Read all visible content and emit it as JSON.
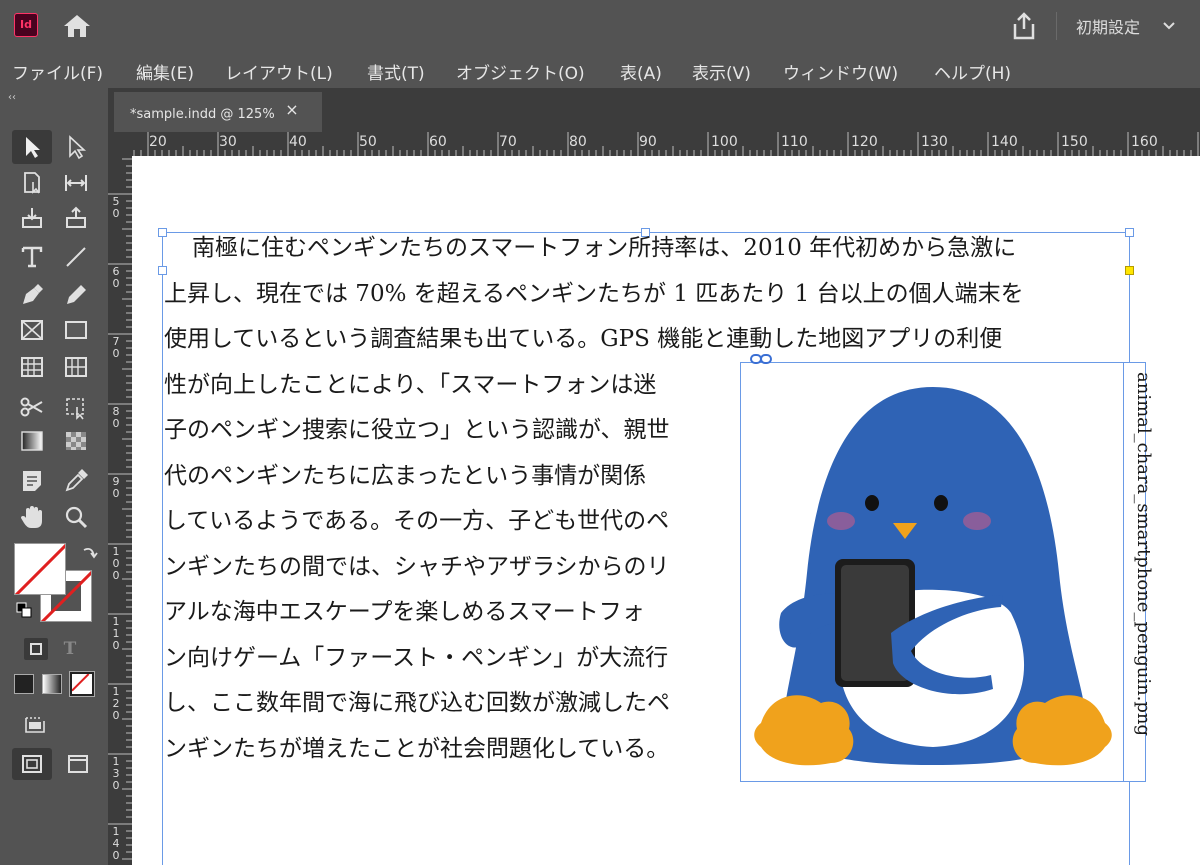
{
  "app": {
    "logo": "Id",
    "workspace": "初期設定"
  },
  "menu": [
    "ファイル(F)",
    "編集(E)",
    "レイアウト(L)",
    "書式(T)",
    "オブジェクト(O)",
    "表(A)",
    "表示(V)",
    "ウィンドウ(W)",
    "ヘルプ(H)"
  ],
  "document_tab": {
    "label": "*sample.indd @ 125%",
    "close": "×"
  },
  "ruler_h": [
    "20",
    "30",
    "40",
    "50",
    "60",
    "70",
    "80",
    "90",
    "100",
    "110",
    "120",
    "130",
    "140",
    "150",
    "160"
  ],
  "ruler_v": [
    "50",
    "60",
    "70",
    "80",
    "90",
    "100",
    "110",
    "120",
    "130",
    "140"
  ],
  "text_lines": [
    "南極に住むペンギンたちのスマートフォン所持率は、2010 年代初めから急激に",
    "上昇し、現在では 70% を超えるペンギンたちが 1 匹あたり 1 台以上の個人端末を",
    "使用しているという調査結果も出ている。GPS 機能と連動した地図アプリの利便",
    "性が向上したことにより、「スマートフォンは迷",
    "子のペンギン捜索に役立つ」という認識が、親世",
    "代のペンギンたちに広まったという事情が関係",
    "しているようである。その一方、子ども世代のペ",
    "ンギンたちの間では、シャチやアザラシからのリ",
    "アルな海中エスケープを楽しめるスマートフォ",
    "ン向けゲーム「ファースト・ペンギン」が大流行",
    "し、ここ数年間で海に飛び込む回数が激減したペ",
    "ンギンたちが増えたことが社会問題化している。"
  ],
  "image": {
    "caption": "animal_chara_smartphone_penguin.png"
  },
  "icons": {
    "home": "home-icon",
    "share": "share-icon",
    "link": "link-icon"
  },
  "colors": {
    "chrome": "#535353",
    "canvas": "#ffffff",
    "frame": "#6a9ae6",
    "penguin_blue": "#2f63b5",
    "penguin_orange": "#f0a21c"
  }
}
